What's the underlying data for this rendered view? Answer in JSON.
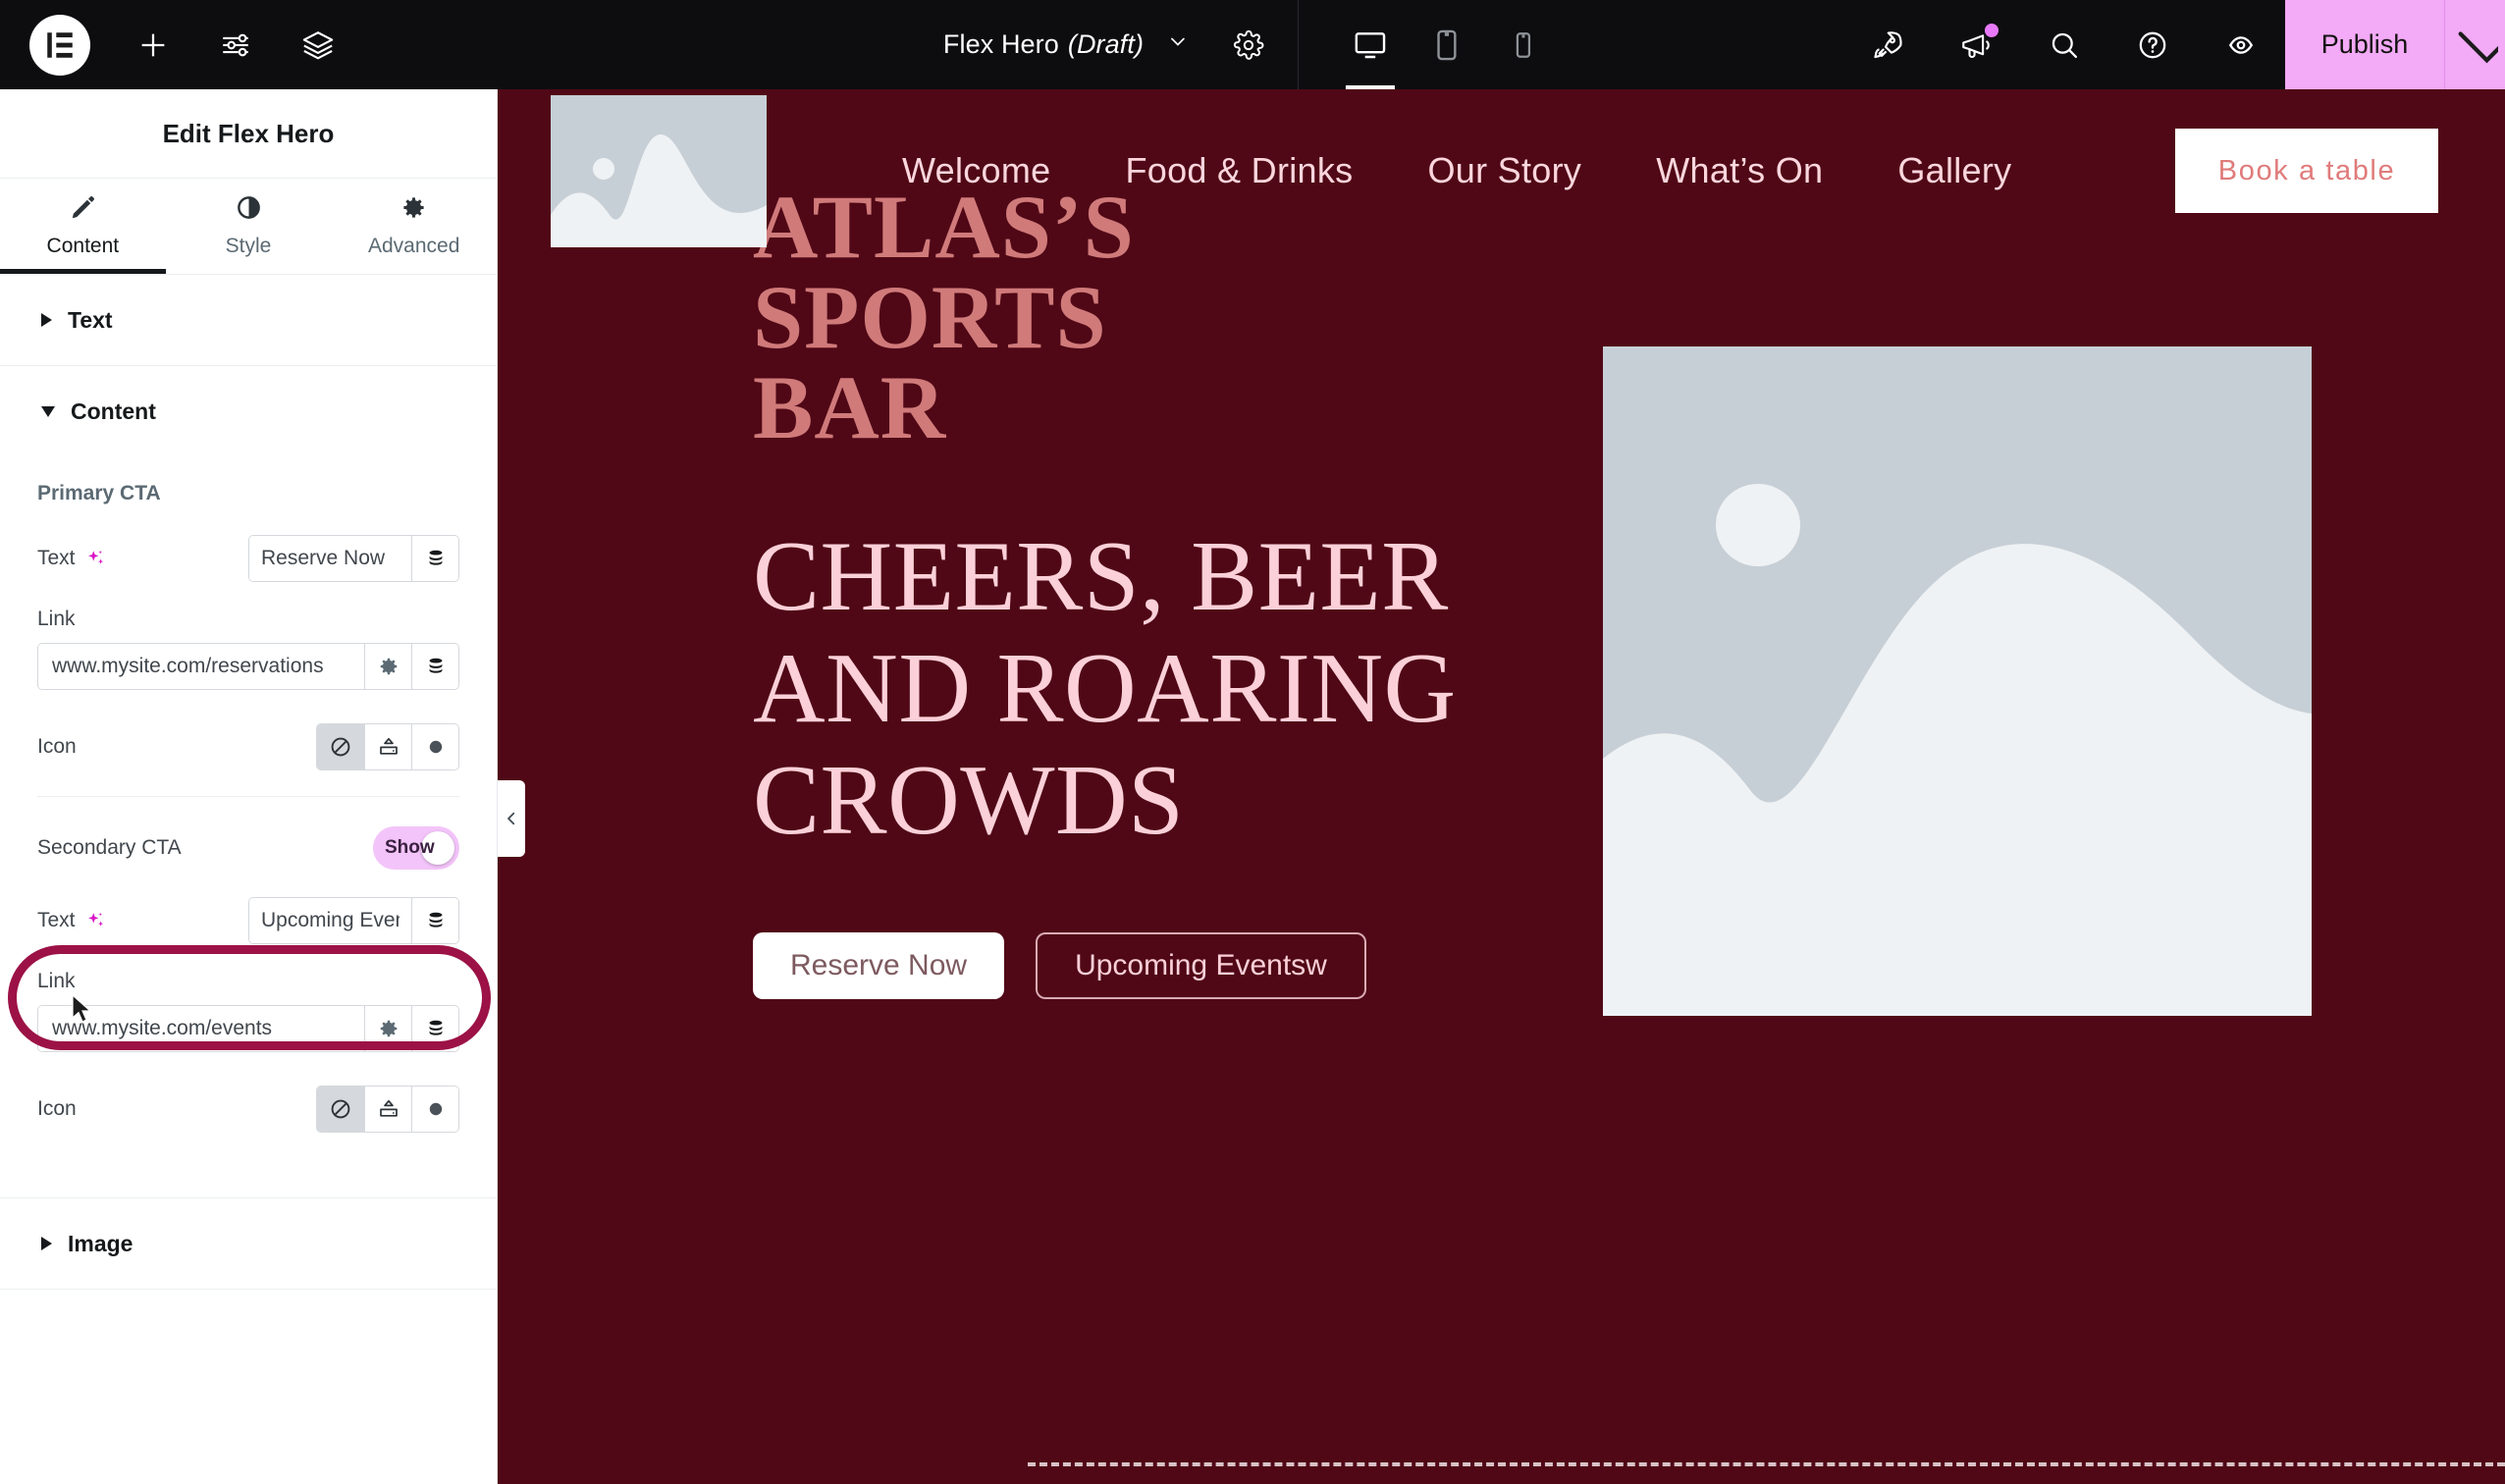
{
  "topbar": {
    "logo_icon": "elementor-logo-icon",
    "add_icon": "plus-icon",
    "settings_sliders_icon": "sliders-icon",
    "layers_icon": "layers-icon",
    "document_title": "Flex Hero",
    "document_status": "(Draft)",
    "title_chevron_icon": "chevron-down-icon",
    "page_settings_icon": "gear-icon",
    "devices": [
      {
        "name": "desktop",
        "icon": "desktop-icon",
        "active": true
      },
      {
        "name": "tablet",
        "icon": "tablet-icon",
        "active": false
      },
      {
        "name": "mobile",
        "icon": "mobile-icon",
        "active": false
      }
    ],
    "right_icons": [
      {
        "name": "site-launch",
        "icon": "rocket-icon"
      },
      {
        "name": "notifications",
        "icon": "megaphone-icon",
        "badge": true
      },
      {
        "name": "finder-search",
        "icon": "search-icon"
      },
      {
        "name": "help",
        "icon": "question-circle-icon"
      },
      {
        "name": "preview-changes",
        "icon": "eye-icon"
      }
    ],
    "publish_label": "Publish",
    "publish_caret_icon": "chevron-down-icon",
    "accent_publish": "#f3aaf7"
  },
  "sidebar": {
    "title": "Edit Flex Hero",
    "tabs": [
      {
        "label": "Content",
        "icon": "pencil-icon",
        "active": true
      },
      {
        "label": "Style",
        "icon": "contrast-half-circle-icon",
        "active": false
      },
      {
        "label": "Advanced",
        "icon": "gear-icon",
        "active": false
      }
    ],
    "sections": {
      "text": {
        "label": "Text",
        "expanded": false,
        "toggle_icon": "triangle-right-icon"
      },
      "content": {
        "label": "Content",
        "expanded": true,
        "toggle_icon": "triangle-down-icon",
        "primary_cta": {
          "group_label": "Primary CTA",
          "text_label": "Text",
          "text_ai_icon": "ai-sparkle-icon",
          "text_value": "Reserve Now",
          "text_dynamic_icon": "database-stack-icon",
          "link_label": "Link",
          "link_value": "www.mysite.com/reservations",
          "link_settings_icon": "gear-icon",
          "link_dynamic_icon": "database-stack-icon",
          "icon_label": "Icon",
          "icon_options": [
            {
              "name": "none",
              "icon": "no-entry-icon",
              "selected": true
            },
            {
              "name": "upload-svg",
              "icon": "upload-tray-icon",
              "selected": false
            },
            {
              "name": "icon-library",
              "icon": "filled-circle-icon",
              "selected": false
            }
          ]
        },
        "secondary_cta": {
          "group_label": "Secondary CTA",
          "toggle_label": "Show",
          "toggle_on": true,
          "text_label": "Text",
          "text_ai_icon": "ai-sparkle-icon",
          "text_value": "Upcoming Event",
          "text_dynamic_icon": "database-stack-icon",
          "link_label": "Link",
          "link_value": "www.mysite.com/events",
          "link_settings_icon": "gear-icon",
          "link_dynamic_icon": "database-stack-icon",
          "icon_label": "Icon",
          "icon_options": [
            {
              "name": "none",
              "icon": "no-entry-icon",
              "selected": true
            },
            {
              "name": "upload-svg",
              "icon": "upload-tray-icon",
              "selected": false
            },
            {
              "name": "icon-library",
              "icon": "filled-circle-icon",
              "selected": false
            }
          ]
        }
      },
      "image": {
        "label": "Image",
        "expanded": false,
        "toggle_icon": "triangle-right-icon"
      }
    },
    "collapse_handle_icon": "chevron-left-icon",
    "highlight_ring_color": "#9c1246"
  },
  "preview": {
    "background_color": "#500816",
    "logo_placeholder_icon": "image-placeholder-icon",
    "nav_links": [
      {
        "label": "Welcome"
      },
      {
        "label": "Food & Drinks"
      },
      {
        "label": "Our Story"
      },
      {
        "label": "What’s On"
      },
      {
        "label": "Gallery"
      }
    ],
    "book_button_label": "Book a table",
    "eyebrow_line1": "ATLAS’S",
    "eyebrow_line2": "SPORTS",
    "eyebrow_line3": "BAR",
    "headline": "CHEERS, BEER AND ROARING CROWDS",
    "primary_button_label": "Reserve Now",
    "secondary_button_label": "Upcoming Eventsw",
    "hero_image_icon": "image-placeholder-icon",
    "heading_color": "#fbd0d8",
    "eyebrow_color": "#d07a7a"
  }
}
